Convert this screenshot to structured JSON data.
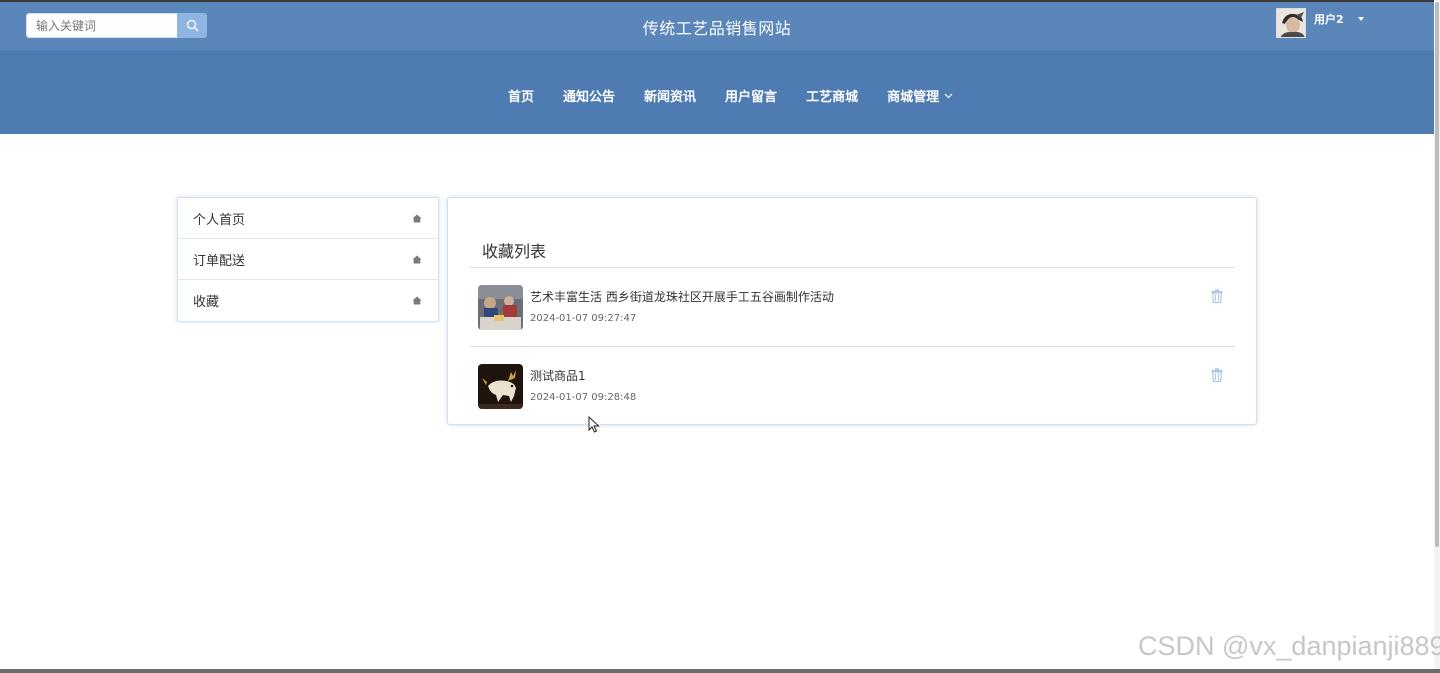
{
  "header": {
    "search_placeholder": "输入关键词",
    "site_title": "传统工艺品销售网站",
    "username": "用户2"
  },
  "nav": {
    "items": [
      {
        "label": "首页"
      },
      {
        "label": "通知公告"
      },
      {
        "label": "新闻资讯"
      },
      {
        "label": "用户留言"
      },
      {
        "label": "工艺商城"
      },
      {
        "label": "商城管理"
      }
    ]
  },
  "sidebar": {
    "items": [
      {
        "label": "个人首页",
        "icon": "home-icon"
      },
      {
        "label": "订单配送",
        "icon": "home-icon"
      },
      {
        "label": "收藏",
        "icon": "home-icon"
      }
    ]
  },
  "favorites": {
    "title": "收藏列表",
    "items": [
      {
        "title": "艺术丰富生活 西乡街道龙珠社区开展手工五谷画制作活动",
        "time": "2024-01-07 09:27:47",
        "icon": "trash-icon"
      },
      {
        "title": "测试商品1",
        "time": "2024-01-07 09:28:48",
        "icon": "trash-icon"
      }
    ]
  },
  "watermark": "CSDN @vx_danpianji889",
  "colors": {
    "topbar": "#5b86ba",
    "navbar": "#4f7bb3",
    "search_button": "#8fb6e3",
    "trash_icon": "#a9c7e8"
  }
}
